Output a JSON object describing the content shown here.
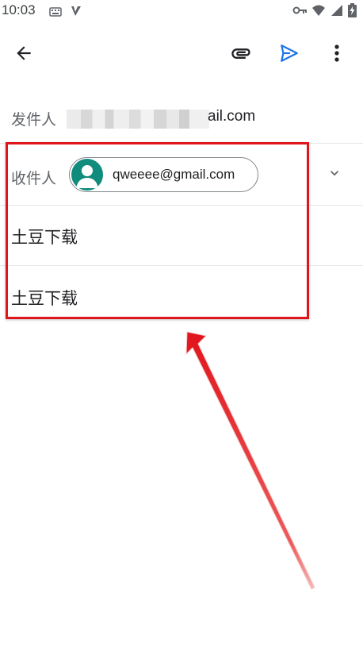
{
  "status_bar": {
    "time": "10:03"
  },
  "app_bar": {
    "icons": {
      "back": "arrow-left-icon",
      "attach": "paperclip-icon",
      "send": "send-icon",
      "more": "more-vert-icon"
    },
    "colors": {
      "send_icon": "#1a73e8",
      "default_icon": "#202124"
    }
  },
  "compose": {
    "from_label": "发件人",
    "from_email_suffix": "ail.com",
    "to_label": "收件人",
    "recipient_email": "qweeee@gmail.com",
    "recipient_avatar_color": "#0f8c7b",
    "subject": "土豆下载",
    "body": "土豆下载"
  },
  "annotation": {
    "color": "#e0151c"
  }
}
